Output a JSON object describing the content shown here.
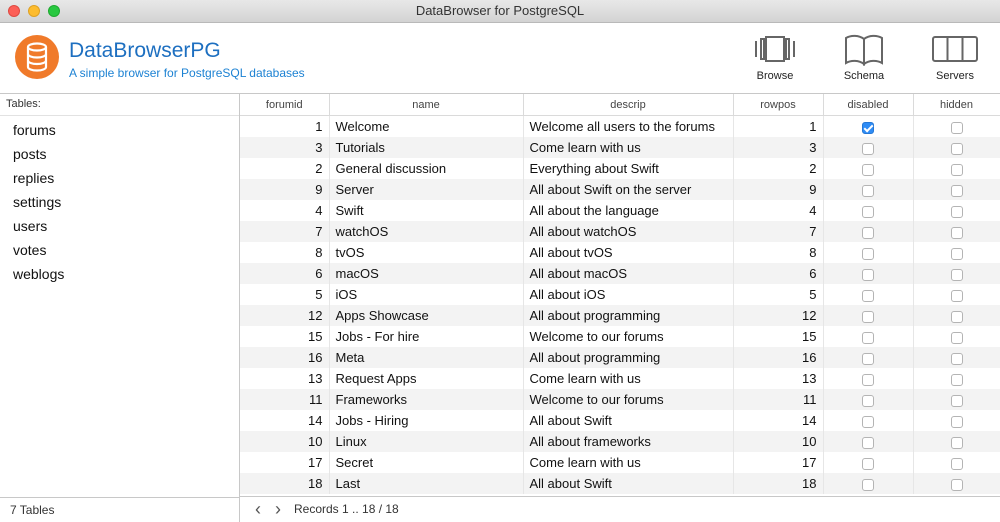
{
  "window": {
    "title": "DataBrowser for PostgreSQL"
  },
  "header": {
    "app_title": "DataBrowserPG",
    "app_subtitle": "A simple browser for PostgreSQL databases",
    "brand_color": "#f07a2a",
    "toolbar": [
      {
        "label": "Browse",
        "icon": "browse-icon"
      },
      {
        "label": "Schema",
        "icon": "schema-book-icon"
      },
      {
        "label": "Servers",
        "icon": "servers-icon"
      }
    ]
  },
  "sidebar": {
    "header": "Tables:",
    "items": [
      "forums",
      "posts",
      "replies",
      "settings",
      "users",
      "votes",
      "weblogs"
    ],
    "footer": "7 Tables"
  },
  "table": {
    "columns": [
      "forumid",
      "name",
      "descrip",
      "rowpos",
      "disabled",
      "hidden"
    ],
    "rows": [
      {
        "forumid": "1",
        "name": "Welcome",
        "descrip": "Welcome all users to the forums",
        "rowpos": "1",
        "disabled": true,
        "hidden": false
      },
      {
        "forumid": "3",
        "name": "Tutorials",
        "descrip": "Come learn with us",
        "rowpos": "3",
        "disabled": false,
        "hidden": false
      },
      {
        "forumid": "2",
        "name": "General discussion",
        "descrip": "Everything about Swift",
        "rowpos": "2",
        "disabled": false,
        "hidden": false
      },
      {
        "forumid": "9",
        "name": "Server",
        "descrip": "All about Swift on the server",
        "rowpos": "9",
        "disabled": false,
        "hidden": false
      },
      {
        "forumid": "4",
        "name": "Swift",
        "descrip": "All about the language",
        "rowpos": "4",
        "disabled": false,
        "hidden": false
      },
      {
        "forumid": "7",
        "name": "watchOS",
        "descrip": "All about watchOS",
        "rowpos": "7",
        "disabled": false,
        "hidden": false
      },
      {
        "forumid": "8",
        "name": "tvOS",
        "descrip": "All about tvOS",
        "rowpos": "8",
        "disabled": false,
        "hidden": false
      },
      {
        "forumid": "6",
        "name": "macOS",
        "descrip": "All about macOS",
        "rowpos": "6",
        "disabled": false,
        "hidden": false
      },
      {
        "forumid": "5",
        "name": "iOS",
        "descrip": "All about iOS",
        "rowpos": "5",
        "disabled": false,
        "hidden": false
      },
      {
        "forumid": "12",
        "name": "Apps Showcase",
        "descrip": "All about programming",
        "rowpos": "12",
        "disabled": false,
        "hidden": false
      },
      {
        "forumid": "15",
        "name": "Jobs - For hire",
        "descrip": "Welcome to our forums",
        "rowpos": "15",
        "disabled": false,
        "hidden": false
      },
      {
        "forumid": "16",
        "name": "Meta",
        "descrip": "All about programming",
        "rowpos": "16",
        "disabled": false,
        "hidden": false
      },
      {
        "forumid": "13",
        "name": "Request Apps",
        "descrip": "Come learn with us",
        "rowpos": "13",
        "disabled": false,
        "hidden": false
      },
      {
        "forumid": "11",
        "name": "Frameworks",
        "descrip": "Welcome to our forums",
        "rowpos": "11",
        "disabled": false,
        "hidden": false
      },
      {
        "forumid": "14",
        "name": "Jobs - Hiring",
        "descrip": "All about Swift",
        "rowpos": "14",
        "disabled": false,
        "hidden": false
      },
      {
        "forumid": "10",
        "name": "Linux",
        "descrip": "All about frameworks",
        "rowpos": "10",
        "disabled": false,
        "hidden": false
      },
      {
        "forumid": "17",
        "name": "Secret",
        "descrip": "Come learn with us",
        "rowpos": "17",
        "disabled": false,
        "hidden": false
      },
      {
        "forumid": "18",
        "name": "Last",
        "descrip": "All about Swift",
        "rowpos": "18",
        "disabled": false,
        "hidden": false
      }
    ]
  },
  "footer": {
    "prev_icon": "chevron-left-icon",
    "next_icon": "chevron-right-icon",
    "records": "Records 1 .. 18 / 18"
  }
}
